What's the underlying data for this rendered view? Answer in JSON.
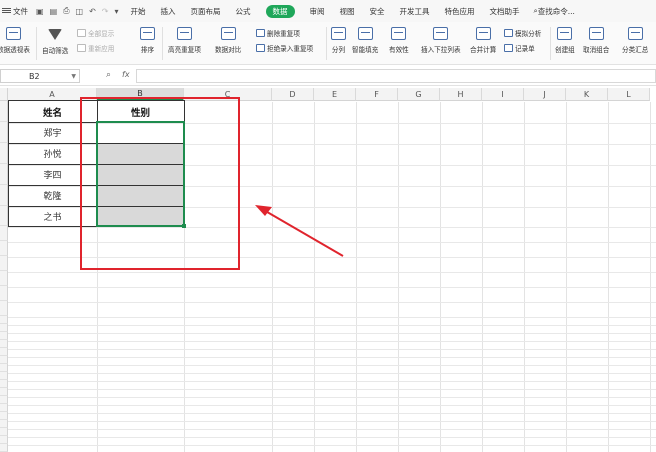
{
  "menubar": {
    "file": "文件",
    "tabs": [
      "开始",
      "插入",
      "页面布局",
      "公式",
      "数据",
      "审阅",
      "视图",
      "安全",
      "开发工具",
      "特色应用",
      "文档助手"
    ],
    "active_tab": "数据",
    "search": "查找命令..."
  },
  "ribbon": {
    "pivot": "数据透视表",
    "autofilter": "自动筛选",
    "show_all": "全部显示",
    "reapply": "重新应用",
    "sort": "排序",
    "highlight_dup": "高亮重复项",
    "data_compare": "数据对比",
    "remove_dup": "删除重复项",
    "reject_dup": "拒绝录入重复项",
    "split": "分列",
    "smart_fill": "智能填充",
    "validity": "有效性",
    "dropdown": "插入下拉列表",
    "merge_calc": "合并计算",
    "simulate": "模拟分析",
    "record": "记录单",
    "create_group": "创建组",
    "ungroup": "取消组合",
    "subtotal": "分类汇总"
  },
  "formula_bar": {
    "cell_ref": "B2",
    "fx_label": "fx",
    "value": ""
  },
  "columns": [
    "A",
    "B",
    "C",
    "D",
    "E",
    "F",
    "G",
    "H",
    "I",
    "J",
    "K",
    "L"
  ],
  "selected_column": "B",
  "table": {
    "headers": [
      "姓名",
      "性别"
    ],
    "names": [
      "郑宇",
      "孙悦",
      "李四",
      "乾隆",
      "之书"
    ]
  },
  "colors": {
    "accent_green": "#1fa75a",
    "selection_green": "#1e8c4e",
    "annotation_red": "#e0242d",
    "grey_fill": "#d9d9d9"
  }
}
